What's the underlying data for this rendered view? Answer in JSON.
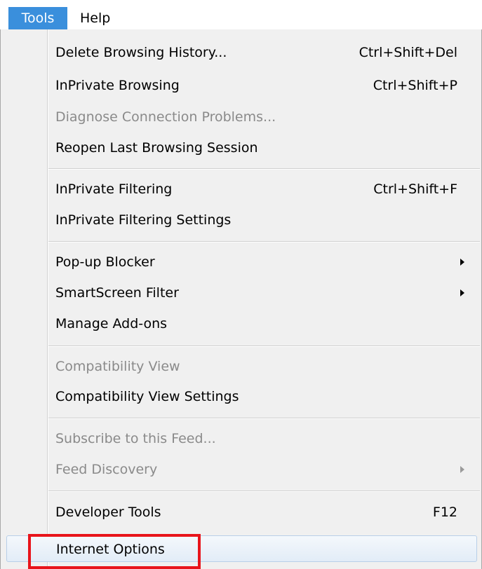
{
  "menubar": {
    "tools_label": "Tools",
    "help_label": "Help"
  },
  "menu": {
    "items": [
      {
        "label": "Delete Browsing History...",
        "shortcut": "Ctrl+Shift+Del"
      },
      {
        "label": "InPrivate Browsing",
        "shortcut": "Ctrl+Shift+P"
      },
      {
        "label": "Diagnose Connection Problems...",
        "disabled": true
      },
      {
        "label": "Reopen Last Browsing Session"
      },
      {
        "label": "InPrivate Filtering",
        "shortcut": "Ctrl+Shift+F"
      },
      {
        "label": "InPrivate Filtering Settings"
      },
      {
        "label": "Pop-up Blocker",
        "submenu": true
      },
      {
        "label": "SmartScreen Filter",
        "submenu": true
      },
      {
        "label": "Manage Add-ons"
      },
      {
        "label": "Compatibility View",
        "disabled": true
      },
      {
        "label": "Compatibility View Settings"
      },
      {
        "label": "Subscribe to this Feed...",
        "disabled": true
      },
      {
        "label": "Feed Discovery",
        "disabled": true,
        "submenu": true
      },
      {
        "label": "Developer Tools",
        "shortcut": "F12"
      },
      {
        "label": "Internet Options",
        "highlighted": true
      }
    ]
  },
  "colors": {
    "menubar_active": "#3a8fdc",
    "highlight_box": "#e8141b"
  }
}
